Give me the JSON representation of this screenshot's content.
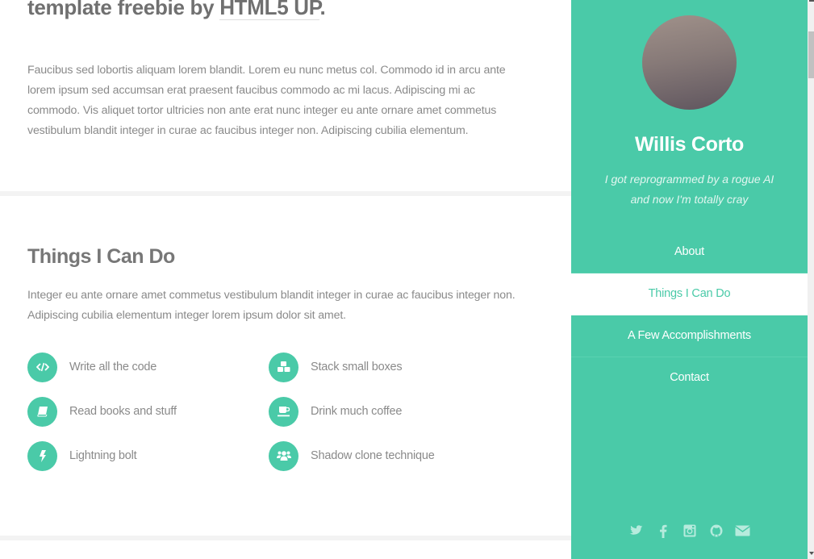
{
  "intro": {
    "title_prefix": "template freebie by ",
    "title_link": "HTML5 UP",
    "title_suffix": ".",
    "paragraph": "Faucibus sed lobortis aliquam lorem blandit. Lorem eu nunc metus col. Commodo id in arcu ante lorem ipsum sed accumsan erat praesent faucibus commodo ac mi lacus. Adipiscing mi ac commodo. Vis aliquet tortor ultricies non ante erat nunc integer eu ante ornare amet commetus vestibulum blandit integer in curae ac faucibus integer non. Adipiscing cubilia elementum."
  },
  "skills": {
    "title": "Things I Can Do",
    "paragraph": "Integer eu ante ornare amet commetus vestibulum blandit integer in curae ac faucibus integer non. Adipiscing cubilia elementum integer lorem ipsum dolor sit amet.",
    "features": [
      {
        "icon": "code-icon",
        "label": "Write all the code"
      },
      {
        "icon": "cubes-icon",
        "label": "Stack small boxes"
      },
      {
        "icon": "book-icon",
        "label": "Read books and stuff"
      },
      {
        "icon": "coffee-icon",
        "label": "Drink much coffee"
      },
      {
        "icon": "bolt-icon",
        "label": "Lightning bolt"
      },
      {
        "icon": "users-icon",
        "label": "Shadow clone technique"
      }
    ]
  },
  "sidebar": {
    "name": "Willis Corto",
    "tagline_line1": "I got reprogrammed by a rogue AI",
    "tagline_line2": "and now I'm totally cray",
    "nav": [
      {
        "label": "About",
        "active": false
      },
      {
        "label": "Things I Can Do",
        "active": true
      },
      {
        "label": "A Few Accomplishments",
        "active": false
      },
      {
        "label": "Contact",
        "active": false
      }
    ],
    "social": [
      "twitter-icon",
      "facebook-icon",
      "instagram-icon",
      "github-icon",
      "email-icon"
    ]
  },
  "colors": {
    "accent": "#4acaa8",
    "text": "#777777",
    "divider": "#f3f3f3"
  }
}
